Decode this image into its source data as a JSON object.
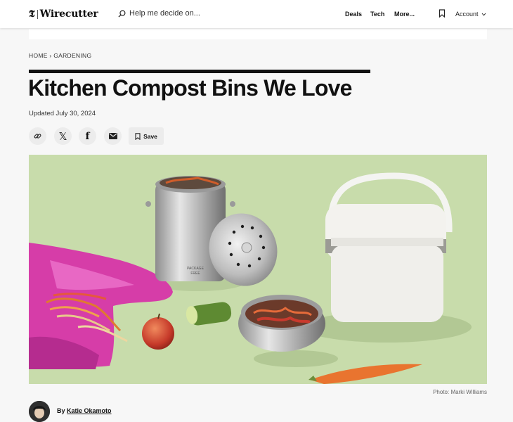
{
  "header": {
    "logo_mark": "𝕿",
    "logo_text": "Wirecutter",
    "search_placeholder": "Help me decide on...",
    "nav": [
      "Deals",
      "Tech",
      "More..."
    ],
    "account_label": "Account"
  },
  "breadcrumb": {
    "home": "HOME",
    "separator": "›",
    "section": "GARDENING"
  },
  "article": {
    "title": "Kitchen Compost Bins We Love",
    "updated": "Updated July 30, 2024",
    "save_label": "Save",
    "share_x_glyph": "𝕏",
    "share_fb_glyph": "f",
    "photo_credit": "Photo: Marki Williams",
    "byline_prefix": "By",
    "author": "Katie Okamoto"
  },
  "hero_image": {
    "canister_text_line1": "PACKAGE",
    "canister_text_line2": "FREE"
  },
  "colors": {
    "background": "#f7f7f7",
    "hero_background": "#c8dcab",
    "text": "#111111"
  }
}
